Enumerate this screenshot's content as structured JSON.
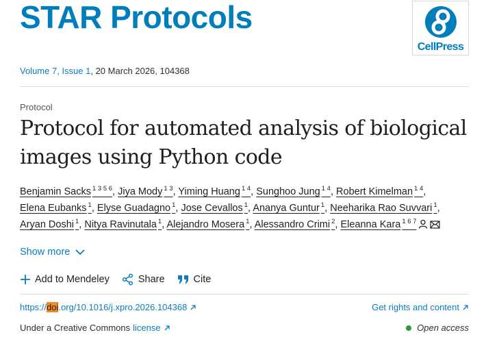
{
  "journal": {
    "name": "STAR Protocols",
    "publisher": "CellPress"
  },
  "issue": {
    "volume_issue": "Volume 7, Issue 1",
    "rest": ", 20 March 2026, 104368"
  },
  "article": {
    "type": "Protocol",
    "title": "Protocol for automated analysis of biological images using Python code"
  },
  "authors": [
    [
      {
        "name": "Benjamin Sacks",
        "sup": "1 3 5 6"
      },
      {
        "name": "Jiya Mody",
        "sup": "1 3"
      },
      {
        "name": "Yiming Huang",
        "sup": "1 4"
      },
      {
        "name": "Sunghoo Jung",
        "sup": "1 4"
      },
      {
        "name": "Robert Kimelman",
        "sup": "1 4"
      }
    ],
    [
      {
        "name": "Elena Eubanks",
        "sup": "1"
      },
      {
        "name": "Elyse Guadagno",
        "sup": "1"
      },
      {
        "name": "Jose Cevallos",
        "sup": "1"
      },
      {
        "name": "Ananya Guntur",
        "sup": "1"
      },
      {
        "name": "Neeharika Rao Suvvari",
        "sup": "1"
      }
    ],
    [
      {
        "name": "Aryan Doshi",
        "sup": "1"
      },
      {
        "name": "Nitya Ravinutala",
        "sup": "1"
      },
      {
        "name": "Alejandro Mosera",
        "sup": "1"
      },
      {
        "name": "Alessandro Crimi",
        "sup": "2"
      },
      {
        "name": "Eleanna Kara",
        "sup": "1 6 7"
      }
    ]
  ],
  "author_icons": [
    "person-icon",
    "envelope-icon"
  ],
  "show_more": "Show more",
  "actions": {
    "mendeley": "Add to Mendeley",
    "share": "Share",
    "cite": "Cite"
  },
  "doi": {
    "prefix": "https://",
    "highlight": "doi",
    "suffix": ".org/10.1016/j.xpro.2026.104368"
  },
  "rights": "Get rights and content",
  "license": {
    "text": "Under a Creative Commons",
    "link": "license"
  },
  "open_access": "Open access",
  "colors": {
    "brand": "#007dbb",
    "link": "#0c7dbb",
    "highlight": "#f28c28",
    "open_access_dot": "#2e9b3a"
  }
}
